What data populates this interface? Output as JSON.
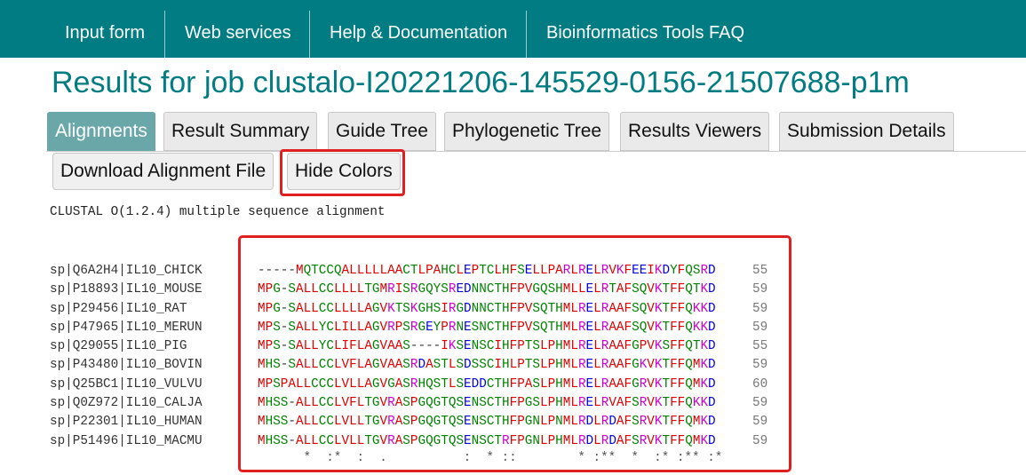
{
  "nav": {
    "items": [
      "Input form",
      "Web services",
      "Help & Documentation",
      "Bioinformatics Tools FAQ"
    ]
  },
  "page": {
    "title": "Results for job clustalo-I20221206-145529-0156-21507688-p1m"
  },
  "tabs": [
    "Alignments",
    "Result Summary",
    "Guide Tree",
    "Phylogenetic Tree",
    "Results Viewers",
    "Submission Details"
  ],
  "active_tab": "Alignments",
  "actions": {
    "download_label": "Download Alignment File",
    "hide_colors_label": "Hide Colors"
  },
  "alignment": {
    "header": "CLUSTAL O(1.2.4) multiple sequence alignment",
    "rows": [
      {
        "name": "sp|Q6A2H4|IL10_CHICK",
        "seq": "-----MQTCCQALLLLLAACTLPAHCLEPTCLHFSELLPARLRELRVKFEEIKDYFQSRD",
        "count": "55"
      },
      {
        "name": "sp|P18893|IL10_MOUSE",
        "seq": "MPG-SALLCCLLLLTGMRISRGQYSREDNNCTHFPVGQSHMLLELRTAFSQVKTFFQTKD",
        "count": "59"
      },
      {
        "name": "sp|P29456|IL10_RAT",
        "seq": "MPG-SALLCCLLLLAGVKTSKGHSIRGDNNCTHFPVSQTHMLRELRAAFSQVKTFFQKKD",
        "count": "59"
      },
      {
        "name": "sp|P47965|IL10_MERUN",
        "seq": "MPS-SALLYCLILLAGVRPSRGEYPRNESNCTHFPVSQTHMLRELRAAFSQVKTFFQKKD",
        "count": "59"
      },
      {
        "name": "sp|Q29055|IL10_PIG",
        "seq": "MPS-SALLYCLIFLAGVAAS----IKSENSCIHFPTSLPHMLRELRAAFGPVKSFFQTKD",
        "count": "55"
      },
      {
        "name": "sp|P43480|IL10_BOVIN",
        "seq": "MHS-SALLCCLVFLAGVAASRDASTLSDSSCIHLPTSLPHMLRELRAAFGKVKTFFQMKD",
        "count": "59"
      },
      {
        "name": "sp|Q25BC1|IL10_VULVU",
        "seq": "MPSPALLCCCLVLLAGVGASRHQSTLSEDDCTHFPASLPHMLRELRAAFGRVKTFFQMKD",
        "count": "60"
      },
      {
        "name": "sp|Q0Z972|IL10_CALJA",
        "seq": "MHSS-ALLCCLVFLTGVRASPGQGTQSENSCTHFPGSLPHMLRELRVAFSRVKTFFQKKD",
        "count": "59"
      },
      {
        "name": "sp|P22301|IL10_HUMAN",
        "seq": "MHSS-ALLCCLVLLTGVRASPGQGTQSENSCTHFPGNLPNMLRDLRDAFSRVKTFFQMKD",
        "count": "59"
      },
      {
        "name": "sp|P51496|IL10_MACMU",
        "seq": "MHSS-ALLCCLVLLTGVRASPGQGTQSENSCTRFPGNLPHMLRDLRDAFSRVKTFFQMKD",
        "count": "59"
      }
    ],
    "consensus": "      *  :*  :  .          :  * ::        * :**  *  :* :** :*"
  },
  "colors": {
    "nav_bg": "#007c82",
    "title": "#007c82",
    "active_tab": "#6aa7a9",
    "highlight": "#e02020",
    "hydrophobic": "#e00000",
    "polar": "#008000",
    "acidic": "#0000dd",
    "basic": "#cc00cc"
  }
}
